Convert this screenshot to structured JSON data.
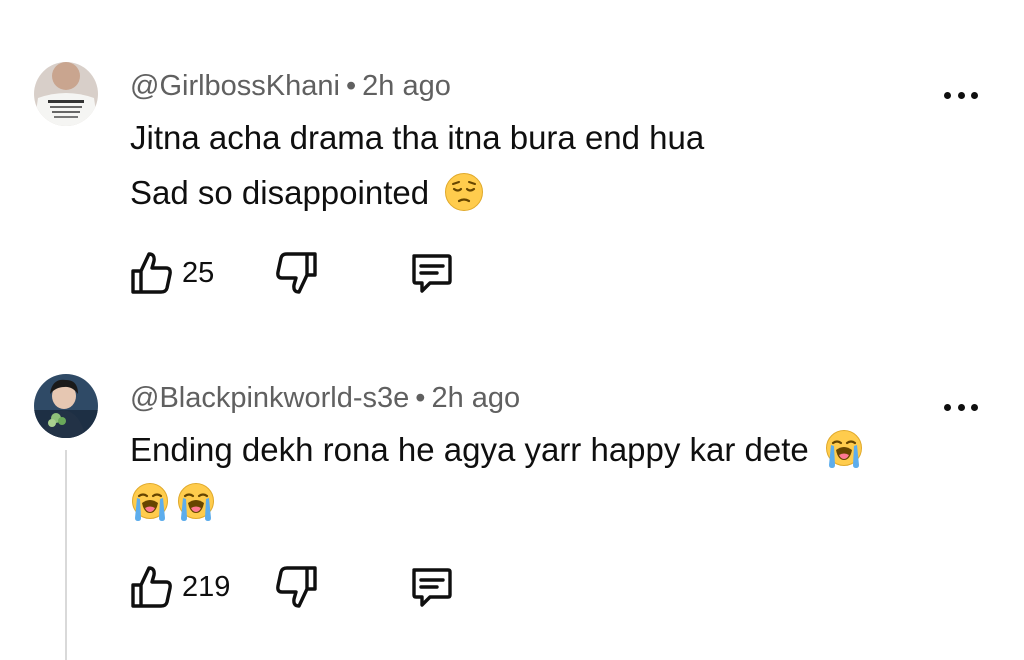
{
  "comments": [
    {
      "author": "@GirlbossKhani",
      "separator": "•",
      "time": "2h ago",
      "line1": "Jitna acha drama tha itna bura end hua",
      "line2": "Sad so disappointed",
      "likes": "25",
      "emoji": "pensive-face"
    },
    {
      "author": "@Blackpinkworld-s3e",
      "separator": "•",
      "time": "2h ago",
      "line1": "Ending dekh rona he agya yarr happy kar dete",
      "line2": "",
      "likes": "219",
      "emoji": "loudly-crying-face"
    }
  ],
  "icons": {
    "like": "thumbs-up-icon",
    "dislike": "thumbs-down-icon",
    "reply": "comment-icon",
    "more": "more-vert-icon"
  },
  "colors": {
    "text": "#0f0f0f",
    "meta": "#606060",
    "thread": "#d9d9d9",
    "emoji_yellow": "#ffcc4d",
    "tear_blue": "#5dadec"
  }
}
